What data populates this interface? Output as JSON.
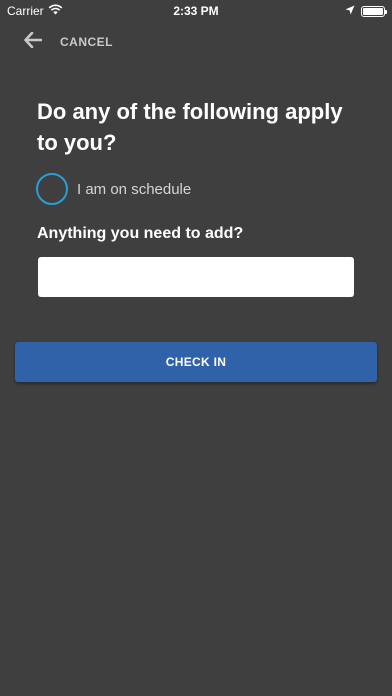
{
  "status_bar": {
    "carrier": "Carrier",
    "time": "2:33 PM",
    "icons": [
      "wifi-icon",
      "location-arrow-icon",
      "battery-icon"
    ]
  },
  "nav": {
    "back_icon": "arrow-left-icon",
    "cancel_label": "CANCEL"
  },
  "form": {
    "question": "Do any of the following apply to you?",
    "options": [
      {
        "label": "I am on schedule",
        "checked": false
      }
    ],
    "add_label": "Anything you need to add?",
    "add_value": "",
    "add_placeholder": ""
  },
  "actions": {
    "checkin_label": "CHECK IN"
  },
  "colors": {
    "background": "#3f3f3f",
    "radio_accent": "#2a9fd6",
    "primary_button": "#2f62a9",
    "muted_text": "#c9c9c9"
  }
}
